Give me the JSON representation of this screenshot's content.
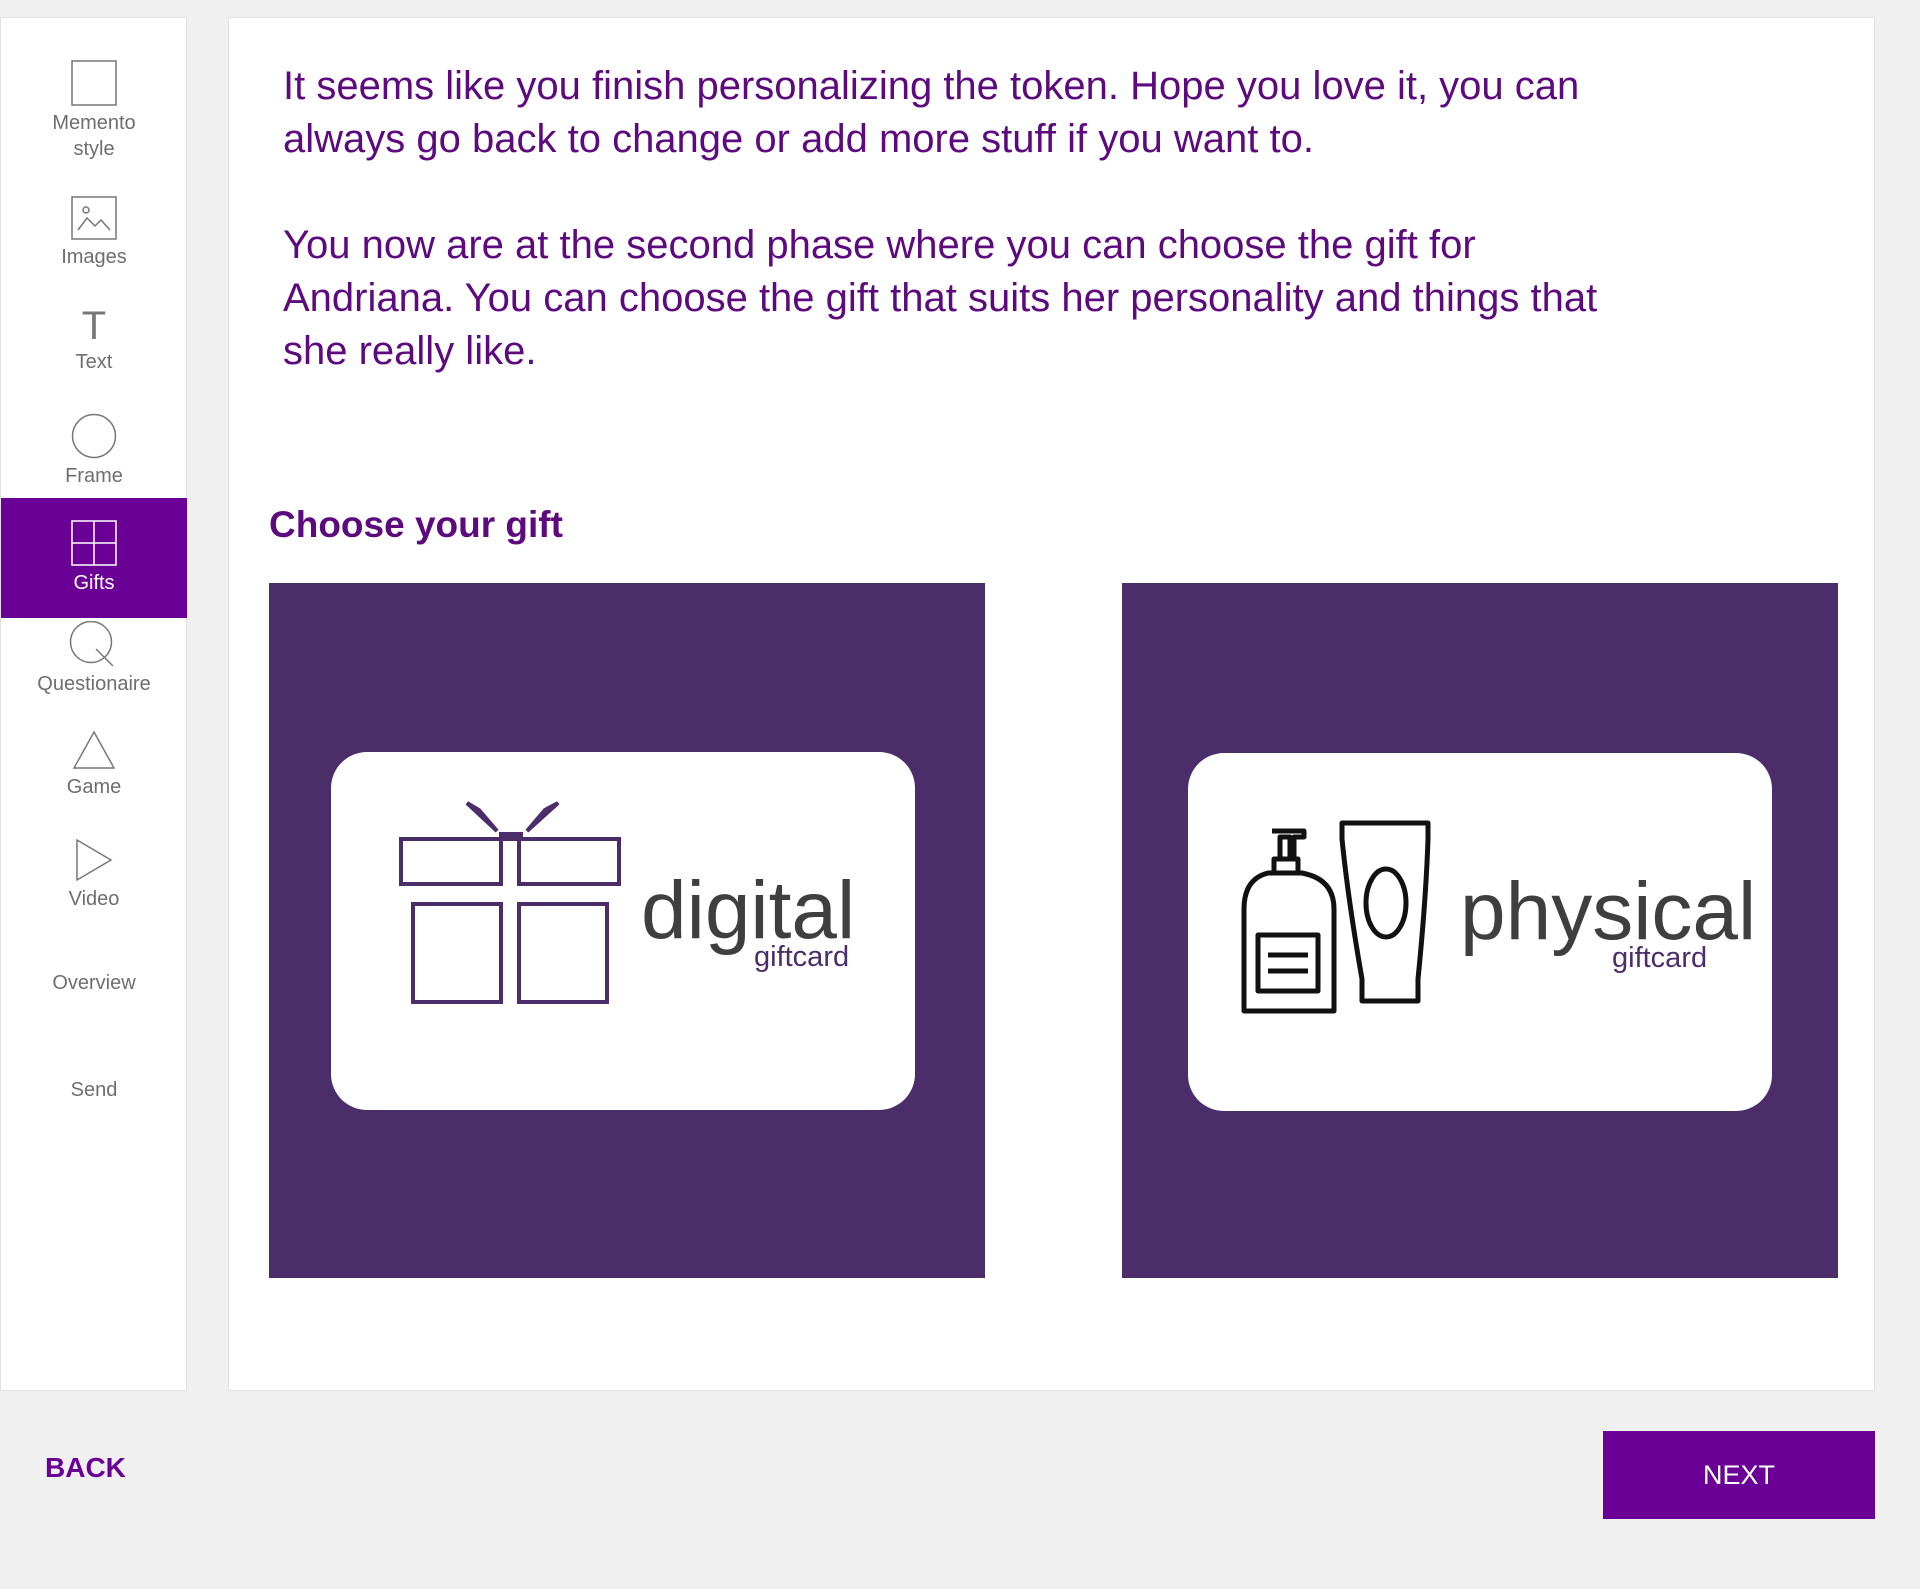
{
  "sidebar": {
    "items": [
      {
        "label": "Memento style",
        "icon": "square-icon"
      },
      {
        "label": "Images",
        "icon": "image-icon"
      },
      {
        "label": "Text",
        "icon": "text-icon"
      },
      {
        "label": "Frame",
        "icon": "circle-icon"
      },
      {
        "label": "Gifts",
        "icon": "grid-icon",
        "active": true
      },
      {
        "label": "Questionaire",
        "icon": "magnifier-icon"
      },
      {
        "label": "Game",
        "icon": "triangle-icon"
      },
      {
        "label": "Video",
        "icon": "play-icon"
      },
      {
        "label": "Overview"
      },
      {
        "label": "Send"
      }
    ]
  },
  "main": {
    "intro_p1": "It seems like you finish personalizing the token. Hope you love it, you can always go back to change or add more stuff if you want to.",
    "intro_p2": "You now are at the second phase where you can choose the gift for Andriana. You can choose the gift that suits her personality and things that she really like.",
    "choose_title": "Choose your gift",
    "gifts": [
      {
        "word": "digital",
        "sub": "giftcard",
        "icon": "gift-box-icon"
      },
      {
        "word": "physical",
        "sub": "giftcard",
        "icon": "toiletries-icon"
      }
    ]
  },
  "footer": {
    "back_label": "BACK",
    "next_label": "NEXT"
  },
  "colors": {
    "accent": "#6a0096",
    "heading_text": "#5c0a7e",
    "tile_bg": "#4b2d6a",
    "nav_text": "#6e6e6e"
  }
}
